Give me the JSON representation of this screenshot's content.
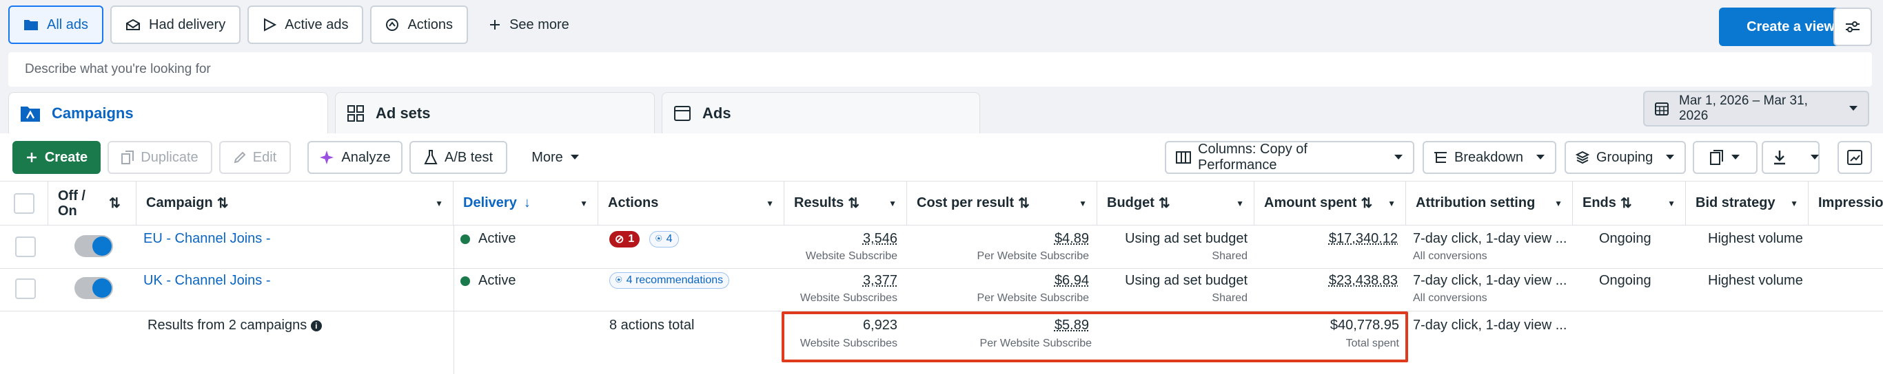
{
  "views": [
    {
      "label": "All ads",
      "icon": "folder-icon"
    },
    {
      "label": "Had delivery",
      "icon": "envelope-icon"
    },
    {
      "label": "Active ads",
      "icon": "play-icon"
    },
    {
      "label": "Actions",
      "icon": "action-icon"
    },
    {
      "label": "See more",
      "icon": "plus-icon"
    }
  ],
  "create_view_label": "Create a view",
  "search": {
    "placeholder": "Describe what you're looking for"
  },
  "level_tabs": [
    {
      "label": "Campaigns",
      "icon": "campaign-icon"
    },
    {
      "label": "Ad sets",
      "icon": "grid-icon"
    },
    {
      "label": "Ads",
      "icon": "ad-icon"
    }
  ],
  "date_range": "Mar 1, 2026 – Mar 31, 2026",
  "toolbar": {
    "create": "Create",
    "duplicate": "Duplicate",
    "edit": "Edit",
    "analyze": "Analyze",
    "ab_test": "A/B test",
    "more": "More",
    "columns": "Columns: Copy of Performance",
    "breakdown": "Breakdown",
    "grouping": "Grouping"
  },
  "columns": {
    "off_on": "Off / On",
    "campaign": "Campaign",
    "delivery": "Delivery",
    "actions": "Actions",
    "results": "Results",
    "cost_per_result": "Cost per result",
    "budget": "Budget",
    "amount_spent": "Amount spent",
    "attribution": "Attribution setting",
    "ends": "Ends",
    "bid_strategy": "Bid strategy",
    "impressions": "Impressio..."
  },
  "rows": [
    {
      "campaign": "EU - Channel Joins -",
      "delivery": "Active",
      "actions_red": "1",
      "actions_blue": "4",
      "results": "3,546",
      "results_sub": "Website Subscribe",
      "cost": "$4.89",
      "cost_sub": "Per Website Subscribe",
      "budget": "Using ad set budget",
      "budget_sub": "Shared",
      "spent": "$17,340.12",
      "attribution": "7-day click, 1-day view ...",
      "attribution_sub": "All conversions",
      "ends": "Ongoing",
      "bid": "Highest volume"
    },
    {
      "campaign": "UK - Channel Joins -",
      "delivery": "Active",
      "actions_reco": "4 recommendations",
      "results": "3,377",
      "results_sub": "Website Subscribes",
      "cost": "$6.94",
      "cost_sub": "Per Website Subscribe",
      "budget": "Using ad set budget",
      "budget_sub": "Shared",
      "spent": "$23,438.83",
      "attribution": "7-day click, 1-day view ...",
      "attribution_sub": "All conversions",
      "ends": "Ongoing",
      "bid": "Highest volume"
    }
  ],
  "totals": {
    "label": "Results from 2 campaigns",
    "actions": "8 actions total",
    "results": "6,923",
    "results_sub": "Website Subscribes",
    "cost": "$5.89",
    "cost_sub": "Per Website Subscribe",
    "spent": "$40,778.95",
    "spent_sub": "Total spent",
    "attribution": "7-day click, 1-day view ..."
  }
}
